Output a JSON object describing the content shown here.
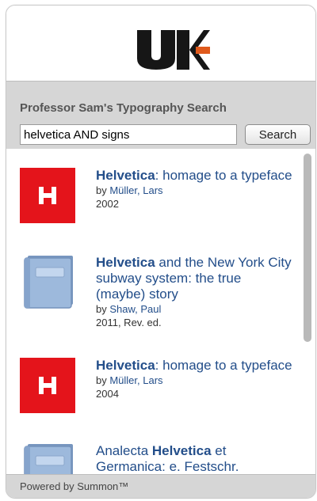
{
  "brand": {
    "logo_text": "UK",
    "accent_color": "#e05a1c"
  },
  "search": {
    "heading": "Professor Sam's Typography Search",
    "query": "helvetica AND signs",
    "button_label": "Search"
  },
  "results": [
    {
      "title_bold": "Helvetica",
      "title_rest": ": homage to a typeface",
      "by": "by ",
      "author": "Müller, Lars",
      "date": "2002",
      "cover": "red-helvetica-cover"
    },
    {
      "title_bold": "Helvetica",
      "title_rest": " and the New York City subway system: the true (maybe) story",
      "by": "by ",
      "author": "Shaw, Paul",
      "date": "2011, Rev. ed.",
      "cover": "generic-book-icon"
    },
    {
      "title_bold": "Helvetica",
      "title_rest": ": homage to a typeface",
      "by": "by ",
      "author": "Müller, Lars",
      "date": "2004",
      "cover": "red-helvetica-cover"
    },
    {
      "title_pre": "Analecta ",
      "title_bold": "Helvetica",
      "title_rest": " et Germanica: e. Festschr.",
      "cover": "generic-book-icon"
    }
  ],
  "footer": {
    "text": "Powered by Summon™"
  },
  "colors": {
    "link": "#234e8a",
    "panel_gray": "#d6d6d6",
    "cover_red": "#e4141b",
    "book_blue": "#8eaed3"
  }
}
